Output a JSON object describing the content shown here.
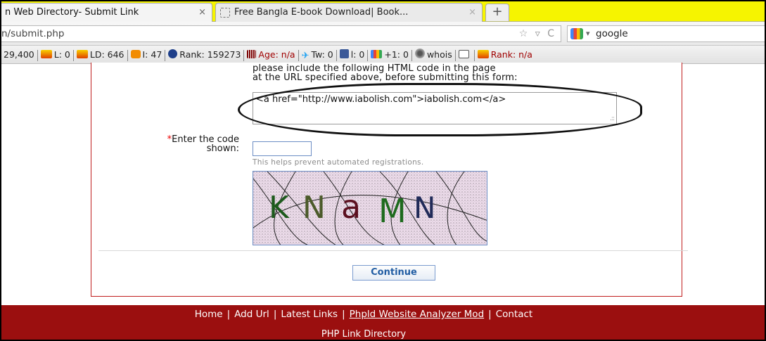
{
  "browser": {
    "tabs": [
      {
        "label": "n Web Directory- Submit Link",
        "close": "×"
      },
      {
        "label": "Free Bangla E-book Download| Book...",
        "close": "×"
      }
    ],
    "new_tab": "+",
    "url": "n/submit.php",
    "url_icons": "☆ ▿ C",
    "search_caret": "▾",
    "search_query": "google"
  },
  "seo_toolbar": [
    {
      "icon": "none",
      "text": "29,400"
    },
    {
      "icon": "flame-icon",
      "text": "L: 0"
    },
    {
      "icon": "flame-icon",
      "text": "LD: 646"
    },
    {
      "icon": "bing-icon",
      "text": "I: 47"
    },
    {
      "icon": "globe-icon",
      "text": "Rank: 159273"
    },
    {
      "icon": "bars-icon",
      "text": "Age: n/a",
      "highlight": true
    },
    {
      "icon": "twitter-icon",
      "text": "Tw: 0"
    },
    {
      "icon": "facebook-icon",
      "text": "l: 0"
    },
    {
      "icon": "gplus-icon",
      "text": "+1: 0"
    },
    {
      "icon": "fingerprint-icon",
      "text": "whois"
    },
    {
      "icon": "code-icon",
      "text": ""
    },
    {
      "icon": "flame-icon",
      "text": "Rank: n/a",
      "highlight": true
    }
  ],
  "form": {
    "notice_line1": "please include the following HTML code in the page",
    "notice_line2": "at the URL specified above, before submitting this form:",
    "code_snippet": "<a href=\"http://www.iabolish.com\">iabolish.com</a>",
    "captcha_label_req": "*",
    "captcha_label_line1": "Enter the code",
    "captcha_label_line2": "shown:",
    "captcha_input_value": "",
    "captcha_hint": "This helps prevent automated registrations.",
    "captcha_text": "KNaMN",
    "continue_label": "Continue"
  },
  "footer": {
    "links": [
      "Home",
      "Add Url",
      "Latest Links",
      "Phpld Website Analyzer Mod",
      "Contact"
    ],
    "brand": "PHP Link Directory"
  },
  "colors": {
    "tabbar": "#f6f400",
    "panel_border": "#c01e1e",
    "footer_bg": "#9b0f0f",
    "captcha_bg": "#ecdbea",
    "button_text": "#215da3"
  }
}
